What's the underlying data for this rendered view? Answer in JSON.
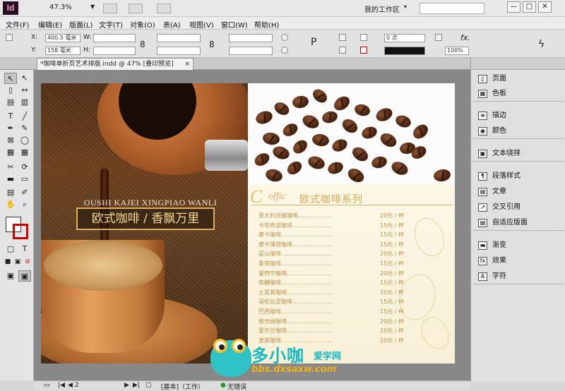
{
  "app": {
    "logo": "Id",
    "zoom": "47.3%",
    "workspace": "我的工作区"
  },
  "window_buttons": [
    "—",
    "□",
    "✕"
  ],
  "menu": [
    "文件(F)",
    "编辑(E)",
    "版面(L)",
    "文字(T)",
    "对象(O)",
    "表(A)",
    "视图(V)",
    "窗口(W)",
    "帮助(H)"
  ],
  "control": {
    "x_label": "X:",
    "y_label": "Y:",
    "w_label": "W:",
    "h_label": "H:",
    "x_value": "400.5 毫米",
    "y_value": "158 毫米",
    "stroke_weight": "0 点",
    "opacity": "100%"
  },
  "document": {
    "tab_title": "*咖啡单折页艺术排版.indd @ 47% [叠印预览]",
    "tab_close": "×"
  },
  "design": {
    "left_title": "OUSHI KAJEI XINGPIAO WANLI",
    "left_tagline": "欧式咖啡 / 香飘万里",
    "coffic_c": "C",
    "coffic_rest": "offic",
    "menu_title": "欧式咖啡系列",
    "menu_items": [
      {
        "name": "意大利浓缩咖啡………………",
        "price": "20元 / 杯"
      },
      {
        "name": "卡布奇诺咖啡…………………",
        "price": "15元 / 杯"
      },
      {
        "name": "摩卡咖啡………………………",
        "price": "15元 / 杯"
      },
      {
        "name": "摩卡薄荷咖啡…………………",
        "price": "15元 / 杯"
      },
      {
        "name": "蓝山咖啡………………………",
        "price": "20元 / 杯"
      },
      {
        "name": "拿铁咖啡………………………",
        "price": "15元 / 杯"
      },
      {
        "name": "曼特宁咖啡……………………",
        "price": "20元 / 杯"
      },
      {
        "name": "焦糖咖啡………………………",
        "price": "15元 / 杯"
      },
      {
        "name": "土耳其咖啡……………………",
        "price": "20元 / 杯"
      },
      {
        "name": "哥伦比亚咖啡…………………",
        "price": "15元 / 杯"
      },
      {
        "name": "巴西咖啡………………………",
        "price": "15元 / 杯"
      },
      {
        "name": "维也纳咖啡……………………",
        "price": "20元 / 杯"
      },
      {
        "name": "爱尔兰咖啡……………………",
        "price": "20元 / 杯"
      },
      {
        "name": "皇家咖啡………………………",
        "price": "20元 / 杯"
      }
    ]
  },
  "panels": [
    {
      "label": "页面",
      "icon": "pages-icon"
    },
    {
      "label": "色板",
      "icon": "swatches-icon"
    },
    {
      "label": "描边",
      "icon": "stroke-icon"
    },
    {
      "label": "颜色",
      "icon": "color-icon"
    },
    {
      "label": "文本绕排",
      "icon": "text-wrap-icon"
    },
    {
      "label": "段落样式",
      "icon": "paragraph-styles-icon"
    },
    {
      "label": "文章",
      "icon": "story-icon"
    },
    {
      "label": "交叉引用",
      "icon": "cross-reference-icon"
    },
    {
      "label": "自适应版面",
      "icon": "liquid-layout-icon"
    },
    {
      "label": "渐变",
      "icon": "gradient-icon"
    },
    {
      "label": "效果",
      "icon": "effects-icon"
    },
    {
      "label": "字符",
      "icon": "character-icon"
    }
  ],
  "status": {
    "page": "2",
    "style": "[基本]（工作）",
    "errors": "无错误"
  },
  "watermark": {
    "name": "多小咖",
    "sub": "爱学网",
    "url": "bbs.dxsaxw.com"
  },
  "colors": {
    "accent_gold": "#d8b060",
    "brand_teal": "#1ab9c2"
  }
}
